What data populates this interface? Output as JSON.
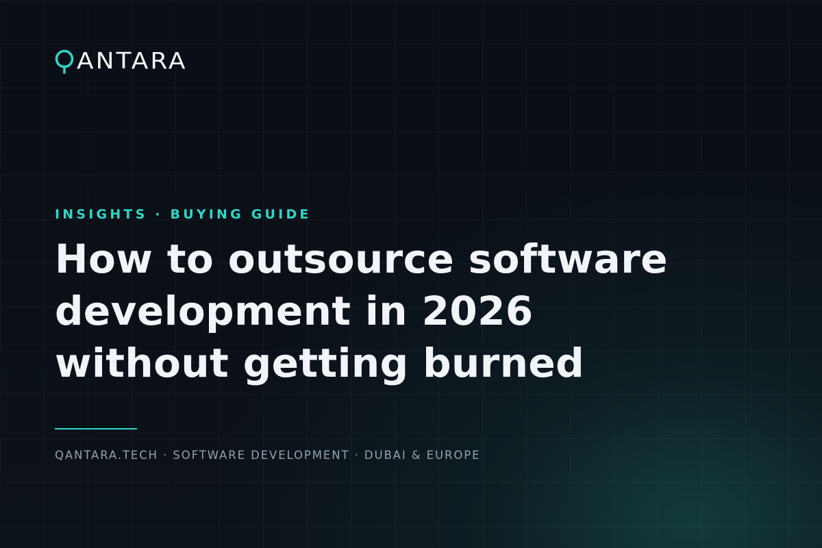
{
  "brand": {
    "logo_text": "ANTARA",
    "logo_mark_icon": "q-ring-icon",
    "accent_color": "#2fd6c8"
  },
  "article": {
    "eyebrow": "INSIGHTS · BUYING GUIDE",
    "headline_lines": [
      "How to outsource software",
      "development in 2026",
      "without getting burned"
    ],
    "footer": "QANTARA.TECH · SOFTWARE DEVELOPMENT · DUBAI & EUROPE"
  }
}
